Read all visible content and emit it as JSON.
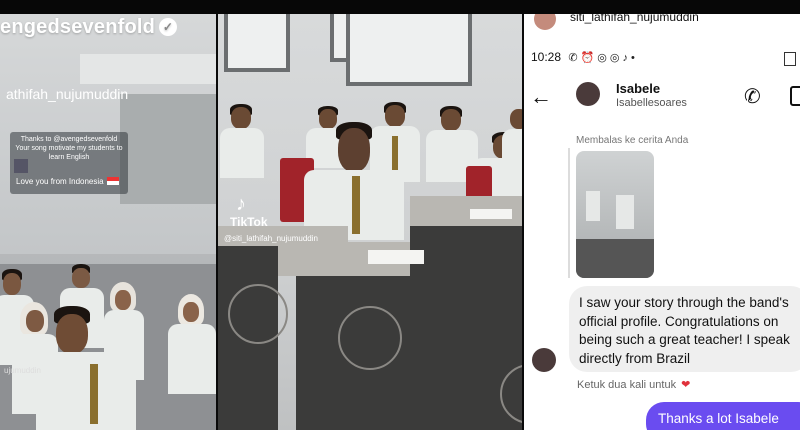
{
  "story_panel": {
    "account_handle": "engedsevenfold",
    "verified_icon": "verified-badge-icon",
    "poster_handle": "athifah_nujumuddin",
    "card_lines": [
      "Thanks to @avengedsevenfold",
      "Your song motivate my students to",
      "learn English"
    ],
    "card_love": "Love you from Indonesia",
    "watermark": "ujumuddin"
  },
  "tiktok_panel": {
    "logo_icon": "tiktok-note-icon",
    "brand": "TikTok",
    "username": "@siti_lathifah_nujumuddin"
  },
  "dm_panel": {
    "overlay_username": "siti_lathifah_nujumuddin",
    "status_time": "10:28",
    "status_icons": [
      "whatsapp-icon",
      "alarm-icon",
      "instagram-icon",
      "instagram-icon",
      "tiktok-icon",
      "more-dots-icon"
    ],
    "contact_name": "Isabele",
    "contact_username": "Isabellesoares",
    "reply_label": "Membalas ke cerita Anda",
    "incoming_lines": [
      "I saw your story through the band's",
      "official profile. Congratulations on",
      "being such a great teacher! I speak",
      "directly from Brazil"
    ],
    "double_tap_hint": "Ketuk dua kali untuk",
    "heart_icon": "heart-icon",
    "outgoing_message": "Thanks  a lot  Isabele"
  }
}
